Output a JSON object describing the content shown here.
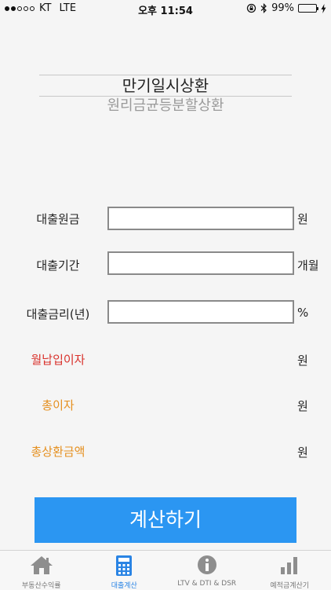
{
  "status": {
    "carrier": "KT",
    "network": "LTE",
    "time": "오후 11:54",
    "battery": "99%",
    "battery_level": 0.99
  },
  "repayment_picker": {
    "selected": "만기일시상환",
    "next_option": "원리금균등분할상환"
  },
  "form": {
    "principal": {
      "label": "대출원금",
      "value": "",
      "unit": "원"
    },
    "period": {
      "label": "대출기간",
      "value": "",
      "unit": "개월"
    },
    "rate": {
      "label": "대출금리(년)",
      "value": "",
      "unit": "%"
    }
  },
  "results": {
    "monthly_interest": {
      "label": "월납입이자",
      "unit": "원"
    },
    "total_interest": {
      "label": "총이자",
      "unit": "원"
    },
    "total_repayment": {
      "label": "총상환금액",
      "unit": "원"
    }
  },
  "calculate_label": "계산하기",
  "tabs": [
    {
      "label": "부동산수익률",
      "icon": "home-icon"
    },
    {
      "label": "대출계산",
      "icon": "calculator-icon"
    },
    {
      "label": "LTV & DTI & DSR",
      "icon": "info-icon"
    },
    {
      "label": "예적금계산기",
      "icon": "bar-chart-icon"
    }
  ],
  "colors": {
    "accent": "#2b96f2",
    "red": "#d9312b",
    "orange": "#e58f1e",
    "active_tab": "#2a84e4"
  }
}
